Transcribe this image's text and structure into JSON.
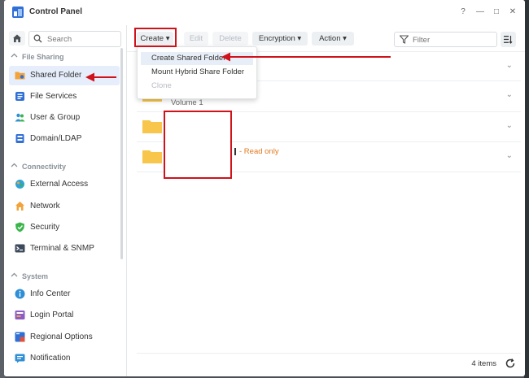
{
  "window": {
    "title": "Control Panel"
  },
  "window_controls": {
    "help": "?",
    "minimize": "—",
    "maximize": "□",
    "close": "✕"
  },
  "sidebar": {
    "search_placeholder": "Search",
    "sections": [
      {
        "label": "File Sharing",
        "items": [
          {
            "label": "Shared Folder",
            "icon": "shared-folder-icon",
            "active": true
          },
          {
            "label": "File Services",
            "icon": "file-services-icon"
          },
          {
            "label": "User & Group",
            "icon": "user-group-icon"
          },
          {
            "label": "Domain/LDAP",
            "icon": "domain-ldap-icon"
          }
        ]
      },
      {
        "label": "Connectivity",
        "items": [
          {
            "label": "External Access",
            "icon": "external-access-icon"
          },
          {
            "label": "Network",
            "icon": "network-icon"
          },
          {
            "label": "Security",
            "icon": "security-icon"
          },
          {
            "label": "Terminal & SNMP",
            "icon": "terminal-icon"
          }
        ]
      },
      {
        "label": "System",
        "items": [
          {
            "label": "Info Center",
            "icon": "info-icon"
          },
          {
            "label": "Login Portal",
            "icon": "login-portal-icon"
          },
          {
            "label": "Regional Options",
            "icon": "regional-options-icon"
          },
          {
            "label": "Notification",
            "icon": "notification-icon"
          }
        ]
      }
    ]
  },
  "toolbar": {
    "create": "Create",
    "edit": "Edit",
    "delete": "Delete",
    "encryption": "Encryption",
    "action": "Action",
    "filter_placeholder": "Filter"
  },
  "create_menu": {
    "items": [
      {
        "label": "Create Shared Folder",
        "highlighted": true
      },
      {
        "label": "Mount Hybrid Share Folder"
      },
      {
        "label": "Clone",
        "disabled": true
      }
    ]
  },
  "list": {
    "rows": [
      {
        "detail": ""
      },
      {
        "detail": "Volume 1"
      },
      {
        "detail": ""
      },
      {
        "detail": "- Read only"
      }
    ],
    "count": "4 items"
  },
  "colors": {
    "accent": "#2f6fd6",
    "folder": "#f7c64a",
    "annotation": "#d0121b",
    "readonly": "#e07a1f"
  }
}
